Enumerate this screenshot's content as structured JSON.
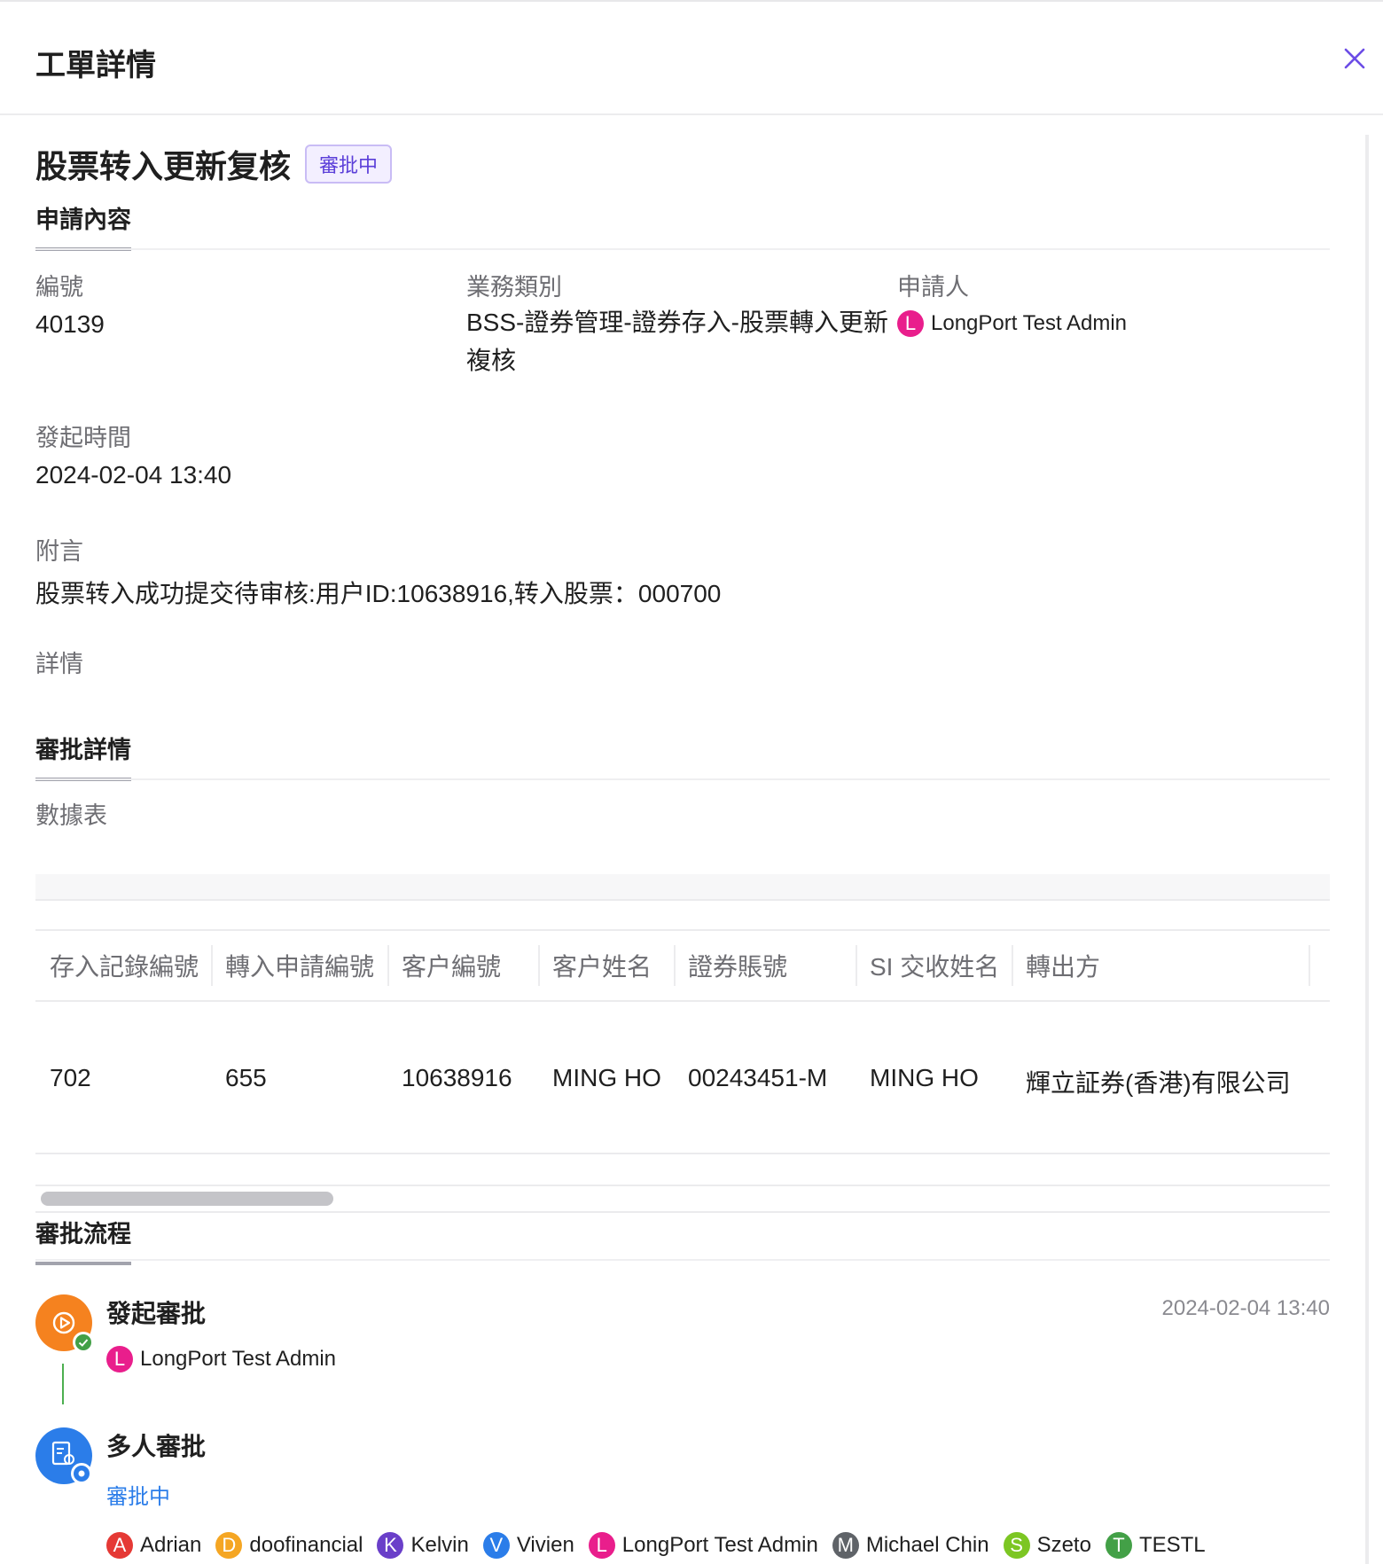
{
  "header": {
    "title": "工單詳情",
    "close_icon": "close-icon",
    "accent": "#6b4ce6"
  },
  "ticket": {
    "title": "股票转入更新复核",
    "status": "審批中"
  },
  "tabs": {
    "application": "申請內容",
    "approval_details": "審批詳情",
    "approval_flow": "審批流程"
  },
  "fields": {
    "id_label": "編號",
    "id_value": "40139",
    "type_label": "業務類別",
    "type_value": "BSS-證券管理-證券存入-股票轉入更新複核",
    "applicant_label": "申請人",
    "applicant_name": "LongPort Test Admin",
    "applicant_initial": "L",
    "time_label": "發起時間",
    "time_value": "2024-02-04 13:40",
    "note_label": "附言",
    "note_value": "股票转入成功提交待审核:用户ID:10638916,转入股票：000700",
    "details_label": "詳情"
  },
  "data_table": {
    "label": "數據表",
    "columns": [
      "存入記錄編號",
      "轉入申請編號",
      "客户編號",
      "客户姓名",
      "證券賬號",
      "SI 交收姓名",
      "轉出方"
    ],
    "rows": [
      [
        "702",
        "655",
        "10638916",
        "MING HO",
        "00243451-M",
        "MING HO",
        "輝立証券(香港)有限公司"
      ]
    ]
  },
  "flow": [
    {
      "title": "發起審批",
      "time": "2024-02-04 13:40",
      "icon": "play-icon",
      "color": "#f5821f",
      "badge_icon": "check-icon",
      "person": {
        "name": "LongPort Test Admin",
        "initial": "L",
        "color": "#e91e8c"
      }
    },
    {
      "title": "多人審批",
      "status": "審批中",
      "icon": "approval-form-icon",
      "color": "#2b7de9",
      "badge_icon": "pending-icon",
      "approvers": [
        {
          "name": "Adrian",
          "initial": "A",
          "color": "#e53935"
        },
        {
          "name": "doofinancial",
          "initial": "D",
          "color": "#f5a623"
        },
        {
          "name": "Kelvin",
          "initial": "K",
          "color": "#6a3fc9"
        },
        {
          "name": "Vivien",
          "initial": "V",
          "color": "#2b7de9"
        },
        {
          "name": "LongPort Test Admin",
          "initial": "L",
          "color": "#e91e8c"
        },
        {
          "name": "Michael Chin",
          "initial": "M",
          "color": "#5f6368"
        },
        {
          "name": "Szeto",
          "initial": "S",
          "color": "#7cc623"
        },
        {
          "name": "TESTL",
          "initial": "T",
          "color": "#43a047"
        }
      ]
    }
  ]
}
